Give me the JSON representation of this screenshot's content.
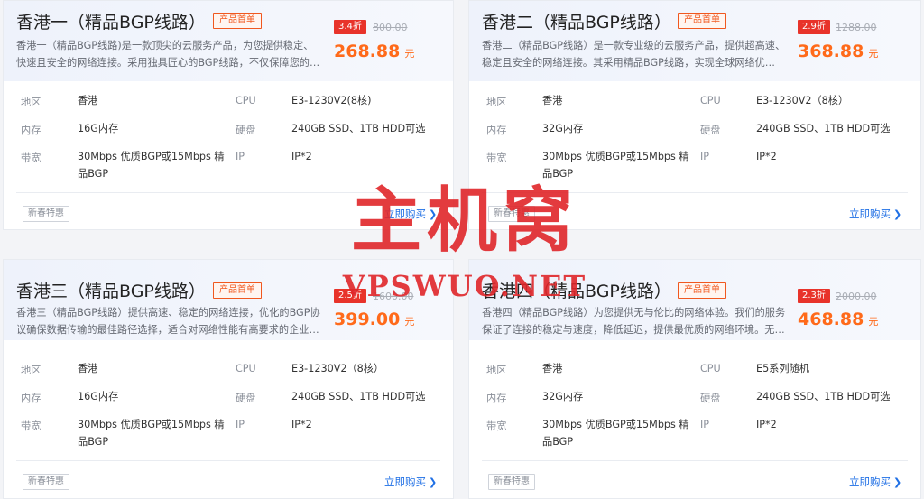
{
  "labels": {
    "region": "地区",
    "cpu": "CPU",
    "memory": "内存",
    "disk": "硬盘",
    "bandwidth": "带宽",
    "ip": "IP",
    "first_order_tag": "产品首单",
    "promo_tag": "新春特惠",
    "buy_label": "立即购买",
    "price_unit": "元"
  },
  "colors": {
    "accent_price": "#ff6a1a",
    "discount_bg": "#e8332a",
    "buy_link": "#1f6fe5",
    "watermark": "#e0262a"
  },
  "products": [
    {
      "title": "香港一（精品BGP线路）",
      "description": "香港一（精品BGP线路)是一款顶尖的云服务产品，为您提供稳定、快速且安全的网络连接。采用独具匠心的BGP线路，不仅保障您的数据...",
      "discount": "3.4折",
      "original_price": "800.00",
      "price": "268.88",
      "region": "香港",
      "cpu": "E3-1230V2(8核)",
      "memory": "16G内存",
      "disk": "240GB SSD、1TB HDD可选",
      "bandwidth": "30Mbps 优质BGP或15Mbps 精品BGP",
      "ip": "IP*2"
    },
    {
      "title": "香港二（精品BGP线路）",
      "description": "香港二（精品BGP线路）是一款专业级的云服务产品，提供超高速、稳定且安全的网络连接。其采用精品BGP线路，实现全球网络优化，...",
      "discount": "2.9折",
      "original_price": "1288.00",
      "price": "368.88",
      "region": "香港",
      "cpu": "E3-1230V2（8核）",
      "memory": "32G内存",
      "disk": "240GB SSD、1TB HDD可选",
      "bandwidth": "30Mbps 优质BGP或15Mbps 精品BGP",
      "ip": "IP*2"
    },
    {
      "title": "香港三（精品BGP线路）",
      "description": "香港三（精品BGP线路）提供高速、稳定的网络连接，优化的BGP协议确保数据传输的最佳路径选择，适合对网络性能有高要求的企业使...",
      "discount": "2.5折",
      "original_price": "1600.00",
      "price": "399.00",
      "region": "香港",
      "cpu": "E3-1230V2（8核）",
      "memory": "16G内存",
      "disk": "240GB SSD、1TB HDD可选",
      "bandwidth": "30Mbps 优质BGP或15Mbps 精品BGP",
      "ip": "IP*2"
    },
    {
      "title": "香港四（精品BGP线路）",
      "description": "香港四（精品BGP线路）为您提供无与伦比的网络体验。我们的服务保证了连接的稳定与速度，降低延迟，提供最优质的网络环境。无论...",
      "discount": "2.3折",
      "original_price": "2000.00",
      "price": "468.88",
      "region": "香港",
      "cpu": "E5系列随机",
      "memory": "32G内存",
      "disk": "240GB SSD、1TB HDD可选",
      "bandwidth": "30Mbps 优质BGP或15Mbps 精品BGP",
      "ip": "IP*2"
    }
  ],
  "watermark": {
    "main": "主机窝",
    "sub": "VPSWUO.NET"
  }
}
